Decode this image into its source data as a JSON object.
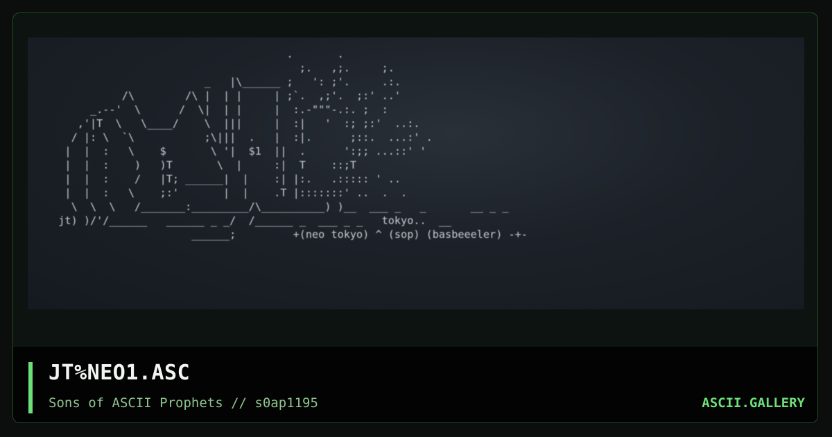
{
  "artwork": {
    "ascii": "                                      .       .\n                                        ;.   ,;.     ;.\n                         _   |\\______ ;   ': ;'.     .:.\n            /\\        /\\ |  | |     | ;`.  ,;'.  ;:' ..'\n       _.--'  \\      /  \\|  | |     |  :.-\"\"\"-.:. ;  :\n     ,'|T  \\   \\____/    \\  |||     |  :|   '  :; ;:'  ..:.\n    / |: \\  `\\           ;\\|||  .   |  :|.      ;::.  ...:' .\n   |  |  :   \\    $       \\ '|  $1  ||  .      ':;; ...::' '\n   |  |  :    )   )T       \\  |     :|  T    ::;T\n   |  |  :    /   |T; ______|  |    :| |:.   .::::: ' ..\n   |  |  :   \\    ;:'       |  |    .T |:::::::' ..  .  .\n    \\  \\  \\   /_______:_________/\\__________) )__  ___ _   _       __ _ _\n  jt) )/'/______   ______ _ _/  /______ _  ___ _ _   tokyo..  __\n                       ______;         +(neo tokyo) ^ (sop) (basbeeeler) -+-"
  },
  "info": {
    "title": "JT%NEO1.ASC",
    "subtitle": "Sons of ASCII Prophets // s0ap1195",
    "brand": "ASCII.GALLERY"
  },
  "colors": {
    "accent": "#6ee07a",
    "card_border": "#254a2c",
    "preview_bg": "#1c2128",
    "footer_bg": "#020302"
  }
}
